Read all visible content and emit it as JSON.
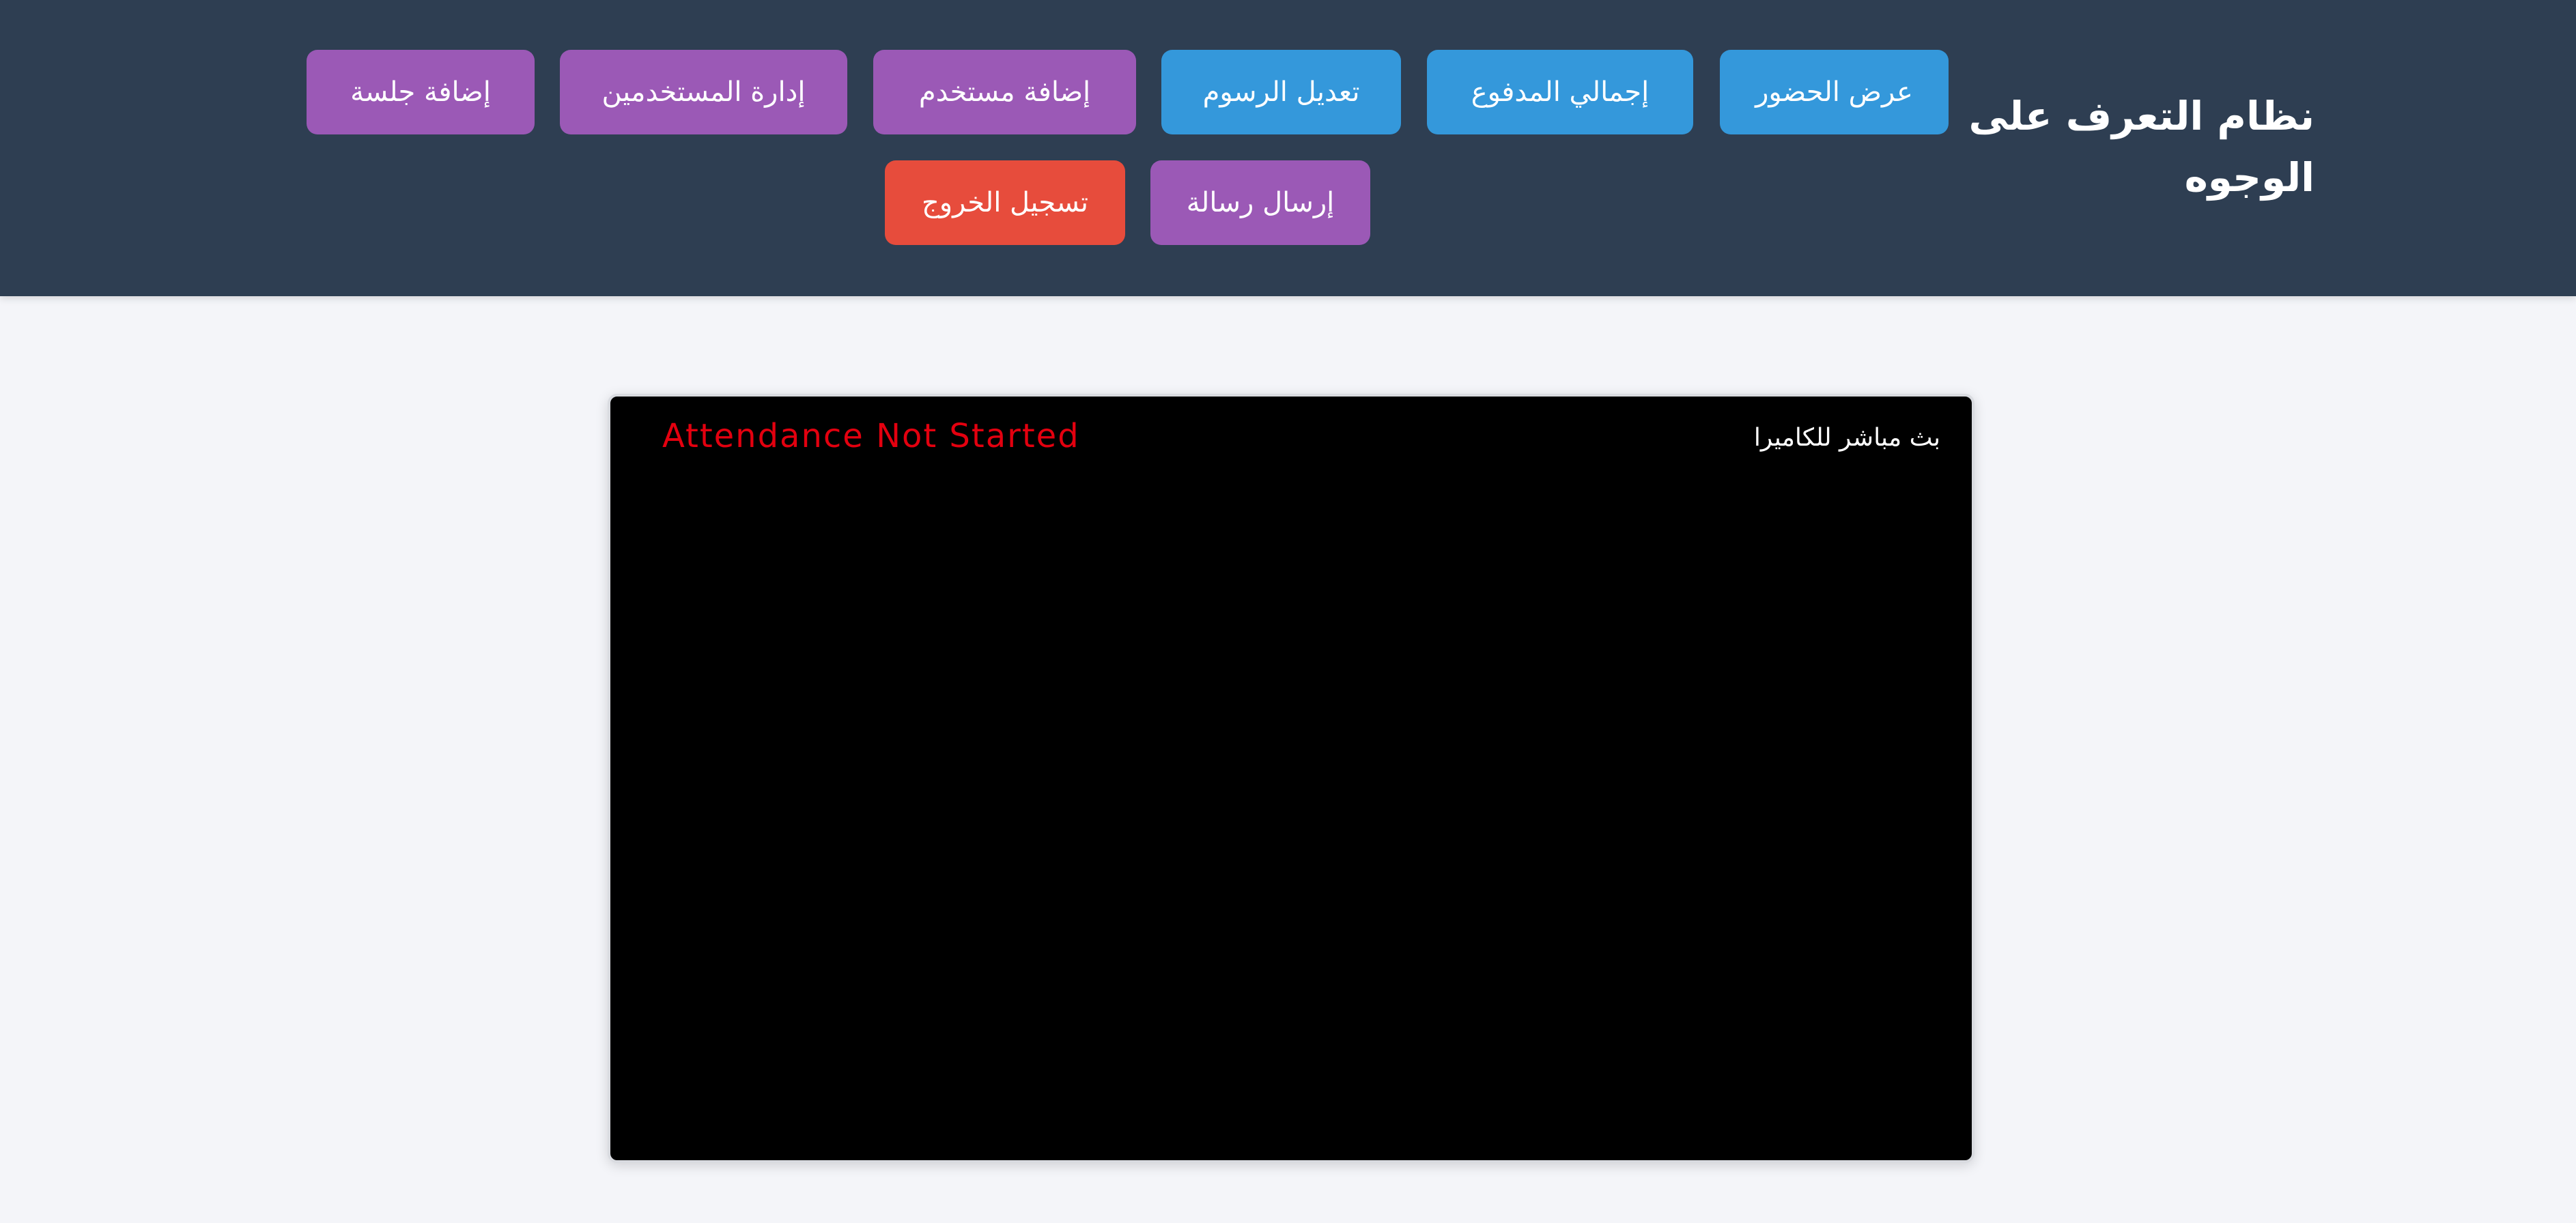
{
  "header": {
    "title": "نظام التعرف على الوجوه",
    "nav": {
      "view_attendance": "عرض الحضور",
      "total_paid": "إجمالي المدفوع",
      "edit_fees": "تعديل الرسوم",
      "add_user": "إضافة مستخدم",
      "manage_users": "إدارة المستخدمين",
      "add_session": "إضافة جلسة",
      "send_message": "إرسال رسالة",
      "logout": "تسجيل الخروج"
    }
  },
  "camera": {
    "live_label": "بث مباشر للكاميرا",
    "status_text": "Attendance Not Started",
    "status_color": "#e3000f"
  },
  "colors": {
    "header_bg": "#2e3e52",
    "page_bg": "#f4f5f9",
    "blue": "#3498db",
    "purple": "#9b59b6",
    "red": "#e74c3c"
  }
}
